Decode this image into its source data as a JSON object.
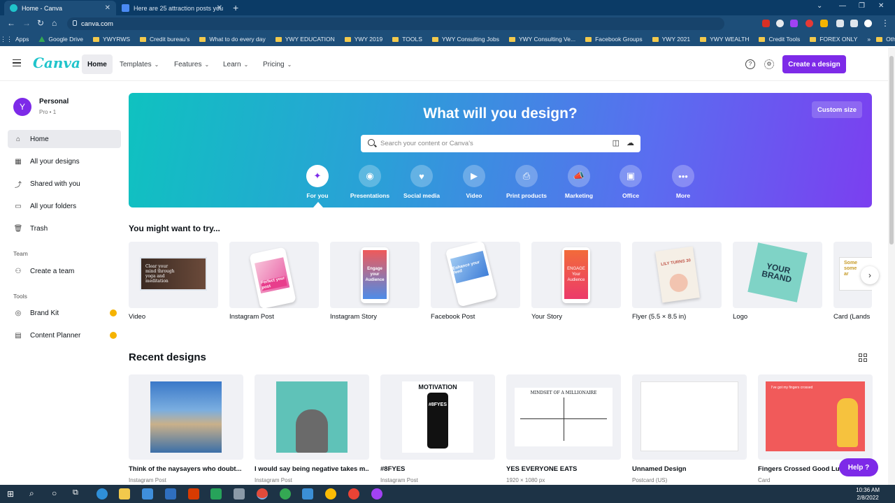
{
  "browser": {
    "tabs": [
      {
        "title": "Home - Canva",
        "active": true
      },
      {
        "title": "Here are 25 attraction posts you",
        "active": false
      }
    ],
    "url": "canva.com",
    "bookmarks": [
      "Apps",
      "Google Drive",
      "YWYRWS",
      "Credit bureau's",
      "What to do every day",
      "YWY EDUCATION",
      "YWY 2019",
      "TOOLS",
      "YWY Consulting Jobs",
      "YWY Consulting Ve...",
      "Facebook Groups",
      "YWY 2021",
      "YWY WEALTH",
      "Credit Tools",
      "FOREX ONLY"
    ],
    "other_bookmarks": "Other bookmarks"
  },
  "header": {
    "logo": "Canva",
    "nav": [
      {
        "label": "Home",
        "active": true
      },
      {
        "label": "Templates"
      },
      {
        "label": "Features"
      },
      {
        "label": "Learn"
      },
      {
        "label": "Pricing"
      }
    ],
    "create_button": "Create a design",
    "avatar_letter": "Y"
  },
  "sidebar": {
    "account_name": "Personal",
    "account_sub": "Pro • 1",
    "avatar_letter": "Y",
    "items": [
      {
        "label": "Home",
        "icon": "home-icon",
        "active": true
      },
      {
        "label": "All your designs",
        "icon": "grid-icon"
      },
      {
        "label": "Shared with you",
        "icon": "share-icon"
      },
      {
        "label": "All your folders",
        "icon": "folder-icon"
      },
      {
        "label": "Trash",
        "icon": "trash-icon"
      }
    ],
    "team_label": "Team",
    "team_item": "Create a team",
    "tools_label": "Tools",
    "tools": [
      {
        "label": "Brand Kit",
        "icon": "brand-kit-icon"
      },
      {
        "label": "Content Planner",
        "icon": "calendar-icon"
      }
    ]
  },
  "banner": {
    "title": "What will you design?",
    "custom_size": "Custom size",
    "search_placeholder": "Search your content or Canva's",
    "categories": [
      {
        "label": "For you",
        "icon": "sparkle-icon",
        "active": true
      },
      {
        "label": "Presentations",
        "icon": "presentation-icon"
      },
      {
        "label": "Social media",
        "icon": "heart-icon"
      },
      {
        "label": "Video",
        "icon": "video-icon"
      },
      {
        "label": "Print products",
        "icon": "print-icon"
      },
      {
        "label": "Marketing",
        "icon": "megaphone-icon"
      },
      {
        "label": "Office",
        "icon": "briefcase-icon"
      },
      {
        "label": "More",
        "icon": "more-icon"
      }
    ]
  },
  "suggestions": {
    "title": "You might want to try...",
    "items": [
      "Video",
      "Instagram Post",
      "Instagram Story",
      "Facebook Post",
      "Your Story",
      "Flyer (5.5 × 8.5 in)",
      "Logo",
      "Card (Lands"
    ],
    "thumb_text": {
      "video": "Clear your mind through yoga and meditation",
      "instagram_post": "Perfect your post",
      "instagram_story": "Engage your Audience",
      "facebook_post": "Enhance your feed",
      "your_story": "ENGAGE Your Audience",
      "flyer": "LILY TURNS 30",
      "logo": "YOUR BRAND",
      "card": "Some some ar"
    }
  },
  "recent": {
    "title": "Recent designs",
    "items": [
      {
        "name": "Think of the naysayers who doubt...",
        "type": "Instagram Post"
      },
      {
        "name": "I would say being negative takes m...",
        "type": "Instagram Post"
      },
      {
        "name": "#8FYES",
        "type": "Instagram Post"
      },
      {
        "name": "YES EVERYONE EATS",
        "type": "1920 × 1080 px"
      },
      {
        "name": "Unnamed Design",
        "type": "Postcard (US)"
      },
      {
        "name": "Fingers Crossed Good Luck",
        "type": "Card"
      }
    ],
    "thumb_text": {
      "motivation": "MOTIVATION",
      "phone": "#8FYES",
      "millionaire": "MINDSET OF A MILLIONAIRE",
      "fingers": "I've got my fingers crossed"
    }
  },
  "help_button": "Help ?",
  "clock": {
    "time": "10:36 AM",
    "date": "2/8/2022"
  }
}
